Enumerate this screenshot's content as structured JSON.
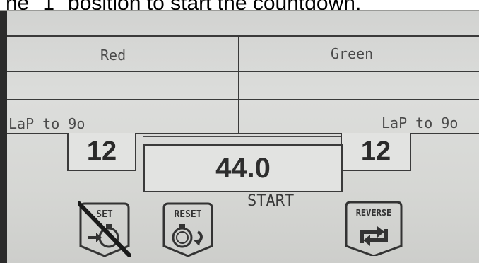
{
  "caption": "ne \"1\" position to start the countdown.",
  "lanes": {
    "left": {
      "color_name": "Red",
      "lap_label": "LaP to 9o",
      "laps": "12"
    },
    "right": {
      "color_name": "Green",
      "lap_label": "LaP to 9o",
      "laps": "12"
    }
  },
  "timer": {
    "value": "44.0"
  },
  "status": "START",
  "buttons": {
    "set": {
      "label": "SET",
      "icon": "stopwatch-arrow-icon",
      "crossed_out": true
    },
    "reset": {
      "label": "RESET",
      "icon": "stopwatch-reset-icon"
    },
    "reverse": {
      "label": "REVERSE",
      "icon": "reverse-arrows-icon"
    }
  }
}
